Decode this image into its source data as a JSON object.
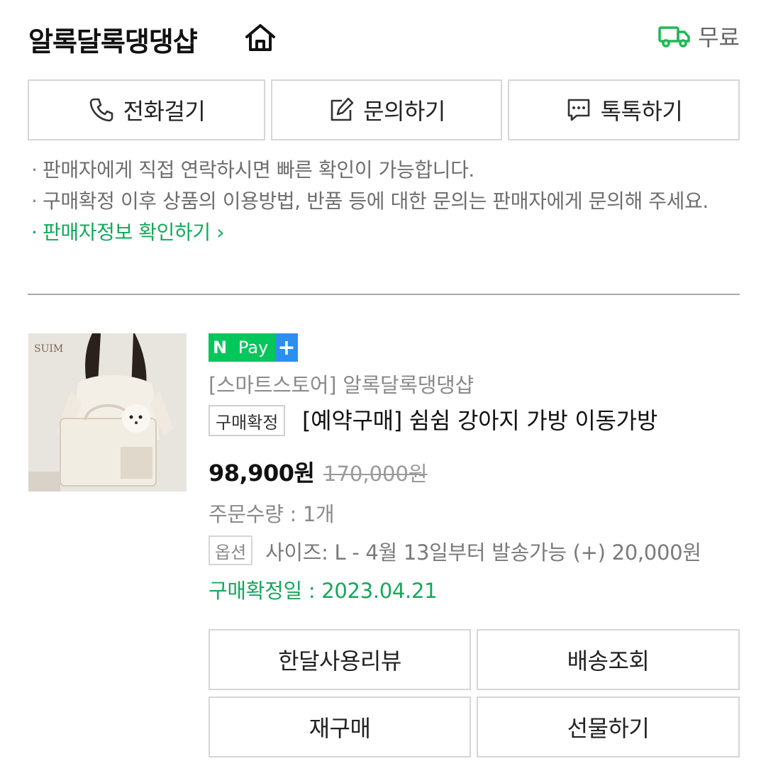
{
  "header": {
    "store_name": "알록달록댕댕샵",
    "shipping_text": "무료",
    "colors": {
      "accent_green": "#14a85a",
      "truck_green": "#1db954"
    }
  },
  "contact_buttons": [
    {
      "icon": "phone-icon",
      "label": "전화걸기"
    },
    {
      "icon": "edit-icon",
      "label": "문의하기"
    },
    {
      "icon": "chat-bubble-icon",
      "label": "톡톡하기"
    }
  ],
  "notes": [
    "판매자에게 직접 연락하시면 빠른 확인이 가능합니다.",
    "구매확정 이후 상품의 이용방법, 반품 등에 대한 문의는 판매자에게 문의해 주세요."
  ],
  "seller_info_link": "판매자정보 확인하기",
  "product": {
    "image_brand_text": "SUIM",
    "npay": {
      "n": "N",
      "pay": "Pay",
      "plus": "+"
    },
    "store_tag": "[스마트스토어] 알록달록댕댕샵",
    "status_badge": "구매확정",
    "title": "[예약구매] 쉼쉼 강아지 가방 이동가방",
    "price": "98,900원",
    "original_price": "170,000원",
    "quantity": "주문수량 : 1개",
    "option_badge": "옵션",
    "option_text": "사이즈: L - 4월 13일부터 발송가능 (+) 20,000원",
    "confirm_date": "구매확정일 : 2023.04.21"
  },
  "actions": {
    "review": "한달사용리뷰",
    "shipping": "배송조회",
    "rebuy": "재구매",
    "gift": "선물하기"
  }
}
